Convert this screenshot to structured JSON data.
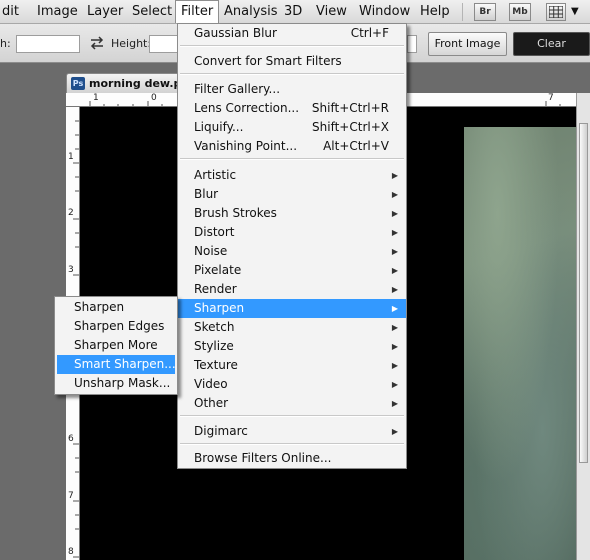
{
  "menubar": {
    "items": [
      "dit",
      "Image",
      "Layer",
      "Select",
      "Filter",
      "Analysis",
      "3D",
      "View",
      "Window",
      "Help"
    ],
    "active": "Filter",
    "badges": [
      "Br",
      "Mb"
    ]
  },
  "options": {
    "width_label": "h:",
    "swap_icon": "swap-arrows-icon",
    "height_label": "Height:",
    "front_image_label": "Front Image",
    "clear_label": "Clear"
  },
  "document": {
    "tab_icon": "Ps",
    "tab_title": "morning dew.ps",
    "hruler": [
      "1",
      "0",
      "7"
    ],
    "vruler": [
      "1",
      "2",
      "3",
      "6",
      "7",
      "8"
    ]
  },
  "filter_menu": {
    "items": [
      {
        "label": "Gaussian Blur",
        "shortcut": "Ctrl+F"
      },
      {
        "label": "Convert for Smart Filters"
      },
      {
        "label": "Filter Gallery..."
      },
      {
        "label": "Lens Correction...",
        "shortcut": "Shift+Ctrl+R"
      },
      {
        "label": "Liquify...",
        "shortcut": "Shift+Ctrl+X"
      },
      {
        "label": "Vanishing Point...",
        "shortcut": "Alt+Ctrl+V"
      },
      {
        "label": "Artistic",
        "submenu": true
      },
      {
        "label": "Blur",
        "submenu": true
      },
      {
        "label": "Brush Strokes",
        "submenu": true
      },
      {
        "label": "Distort",
        "submenu": true
      },
      {
        "label": "Noise",
        "submenu": true
      },
      {
        "label": "Pixelate",
        "submenu": true
      },
      {
        "label": "Render",
        "submenu": true
      },
      {
        "label": "Sharpen",
        "submenu": true,
        "highlighted": true
      },
      {
        "label": "Sketch",
        "submenu": true
      },
      {
        "label": "Stylize",
        "submenu": true
      },
      {
        "label": "Texture",
        "submenu": true
      },
      {
        "label": "Video",
        "submenu": true
      },
      {
        "label": "Other",
        "submenu": true
      },
      {
        "label": "Digimarc",
        "submenu": true
      },
      {
        "label": "Browse Filters Online..."
      }
    ]
  },
  "sharpen_submenu": {
    "items": [
      {
        "label": "Sharpen"
      },
      {
        "label": "Sharpen Edges"
      },
      {
        "label": "Sharpen More"
      },
      {
        "label": "Smart Sharpen...",
        "highlighted": true
      },
      {
        "label": "Unsharp Mask..."
      }
    ]
  },
  "colors": {
    "highlight": "#3399ff",
    "menu_bg": "#f3f3f3",
    "canvas": "#000000"
  }
}
